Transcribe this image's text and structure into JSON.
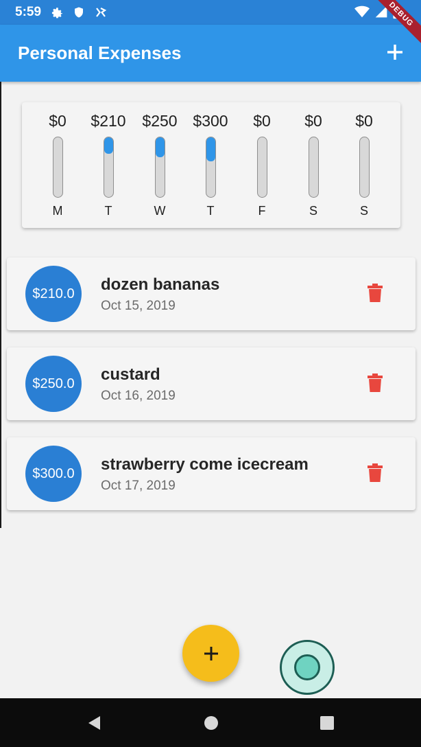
{
  "status_bar": {
    "time": "5:59",
    "icons": [
      "gear-icon",
      "shield-icon",
      "sim-icon"
    ],
    "right_icons": [
      "wifi-icon",
      "signal-icon",
      "battery-icon"
    ],
    "debug_label": "DEBUG"
  },
  "app_bar": {
    "title": "Personal Expenses",
    "add_icon": "plus-icon",
    "color": "#2f95e8"
  },
  "chart": {
    "days": [
      {
        "day": "M",
        "amount": "$0",
        "fraction": 0
      },
      {
        "day": "T",
        "amount": "$210",
        "fraction": 0.28
      },
      {
        "day": "W",
        "amount": "$250",
        "fraction": 0.33
      },
      {
        "day": "T",
        "amount": "$300",
        "fraction": 0.4
      },
      {
        "day": "F",
        "amount": "$0",
        "fraction": 0
      },
      {
        "day": "S",
        "amount": "$0",
        "fraction": 0
      },
      {
        "day": "S",
        "amount": "$0",
        "fraction": 0
      }
    ],
    "fill_color": "#2f95e8"
  },
  "transactions": [
    {
      "amount": "$210.0",
      "title": "dozen bananas",
      "date": "Oct 15, 2019"
    },
    {
      "amount": "$250.0",
      "title": "custard",
      "date": "Oct 16, 2019"
    },
    {
      "amount": "$300.0",
      "title": "strawberry come icecream",
      "date": "Oct 17, 2019"
    }
  ],
  "delete_color": "#e8473e",
  "fab": {
    "icon": "plus-icon",
    "color": "#f5bd1b"
  },
  "nav": {
    "icons": [
      "back-icon",
      "home-icon",
      "recents-icon"
    ]
  }
}
